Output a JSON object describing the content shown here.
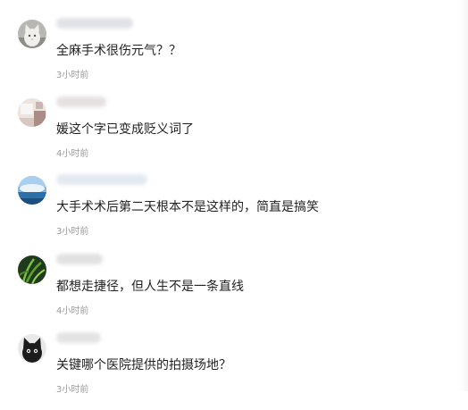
{
  "comments": [
    {
      "avatar": "cat-avatar",
      "text": "全麻手术很伤元气？？",
      "time": "3小时前",
      "name_color": "#dadde2"
    },
    {
      "avatar": "room-avatar",
      "text": "媛这个字已变成贬义词了",
      "time": "4小时前",
      "name_color": "#e2dada"
    },
    {
      "avatar": "sky-avatar",
      "text": "大手术术后第二天根本不是这样的，简直是搞笑",
      "time": "3小时前",
      "name_color": "#dde6ee"
    },
    {
      "avatar": "leaf-avatar",
      "text": "都想走捷径，但人生不是一条直线",
      "time": "4小时前",
      "name_color": "#dcdcdc"
    },
    {
      "avatar": "black-cat-avatar",
      "text": "关键哪个医院提供的拍摄场地？",
      "time": "3小时前",
      "name_color": "#dedede"
    }
  ]
}
